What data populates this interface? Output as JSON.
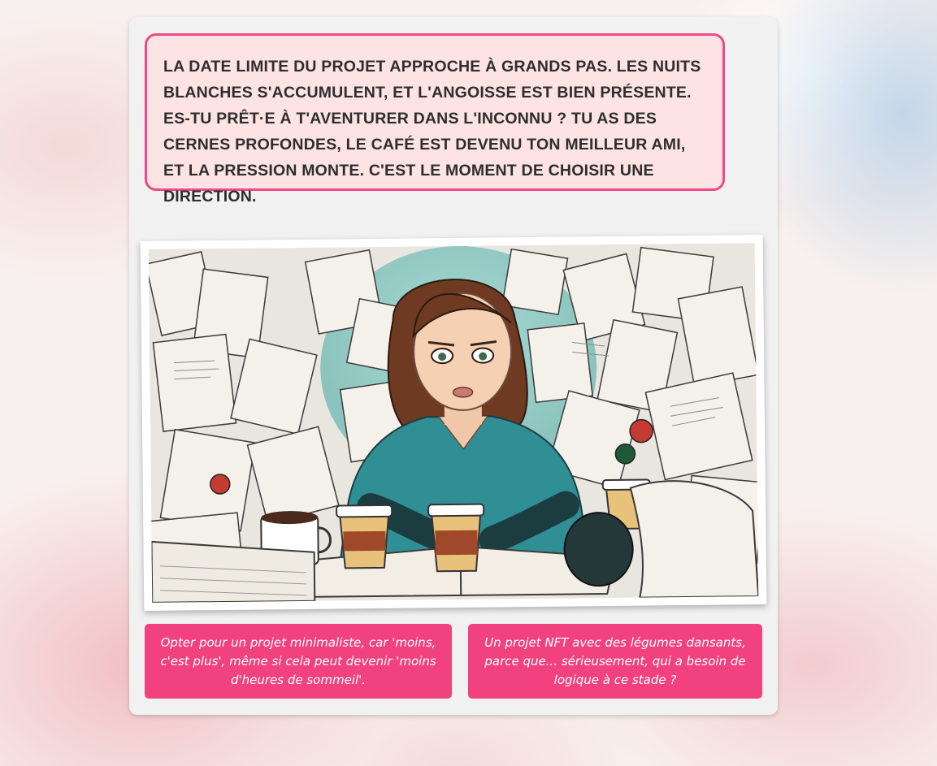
{
  "story": {
    "narrative": "La date limite du projet approche à grands pas. Les nuits blanches s'accumulent, et l'angoisse est bien présente. Es-tu prêt·e à t'aventurer dans l'inconnu ? Tu as des cernes profondes, le café est devenu ton meilleur ami, et la pression monte. C'est le moment de choisir une direction."
  },
  "illustration": {
    "icon": "stressed-woman-with-papers-and-coffee-illustration"
  },
  "choices": [
    {
      "label": "Opter pour un projet minimaliste, car 'moins, c'est plus', même si cela peut devenir 'moins d'heures de sommeil'."
    },
    {
      "label": "Un projet NFT avec des légumes dansants, parce que... sérieusement, qui a besoin de logique à ce stade ?"
    }
  ],
  "colors": {
    "accent": "#f1417e",
    "narrative_border": "#ef4a86",
    "narrative_bg": "#fde3e3",
    "card_bg": "#f1f1f1"
  }
}
